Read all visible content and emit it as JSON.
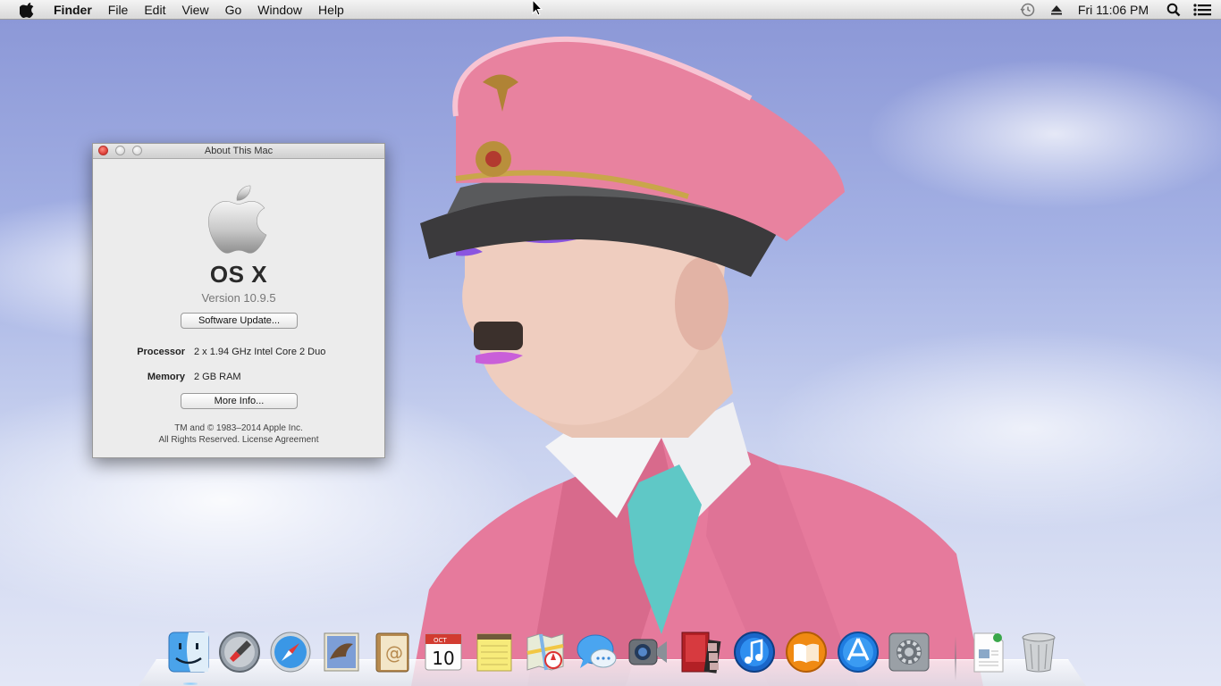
{
  "menubar": {
    "app_name": "Finder",
    "menus": [
      "File",
      "Edit",
      "View",
      "Go",
      "Window",
      "Help"
    ],
    "clock": "Fri 11:06 PM"
  },
  "about_window": {
    "title": "About This Mac",
    "os_name": "OS X",
    "version": "Version 10.9.5",
    "software_update_label": "Software Update...",
    "processor_label": "Processor",
    "processor_value": "2 x 1.94 GHz Intel Core 2 Duo",
    "memory_label": "Memory",
    "memory_value": "2 GB RAM",
    "more_info_label": "More Info...",
    "legal_line1": "TM and © 1983–2014 Apple Inc.",
    "legal_line2": "All Rights Reserved.  License Agreement"
  },
  "dock": {
    "items": [
      "finder-icon",
      "launchpad-icon",
      "safari-icon",
      "mail-icon",
      "contacts-icon",
      "calendar-icon",
      "notes-icon",
      "maps-icon",
      "messages-icon",
      "facetime-icon",
      "photo-booth-icon",
      "itunes-icon",
      "ibooks-icon",
      "app-store-icon",
      "system-preferences-icon",
      "document-icon",
      "trash-icon"
    ],
    "calendar_month": "OCT",
    "calendar_day": "10"
  },
  "colors": {
    "accent_blue": "#1f7ce0",
    "close_red": "#e0443e",
    "jacket_pink": "#e86f95"
  }
}
